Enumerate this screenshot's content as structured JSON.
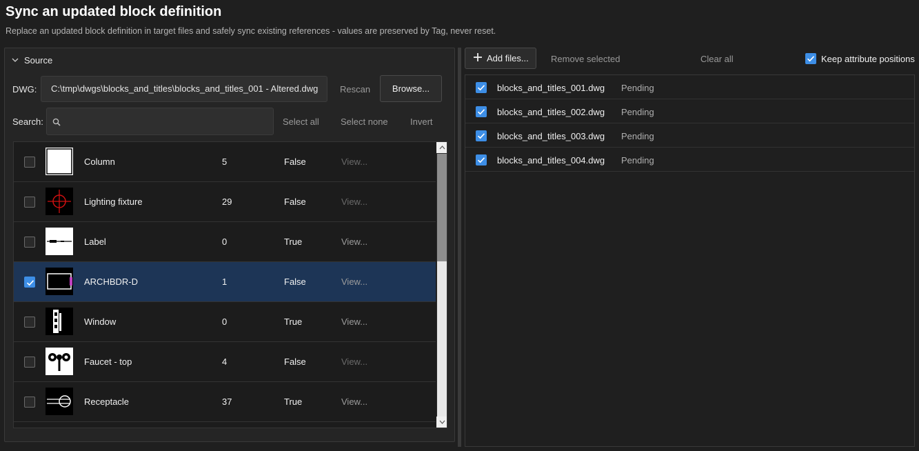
{
  "header": {
    "title": "Sync an updated block definition",
    "subtitle": "Replace an updated block definition in target files and safely sync existing references - values are preserved by Tag, never reset."
  },
  "source": {
    "section_label": "Source",
    "dwg_label": "DWG:",
    "dwg_path": "C:\\tmp\\dwgs\\blocks_and_titles\\blocks_and_titles_001 - Altered.dwg",
    "rescan_label": "Rescan",
    "browse_label": "Browse...",
    "search_label": "Search:",
    "search_value": "",
    "select_all_label": "Select all",
    "select_none_label": "Select none",
    "invert_label": "Invert"
  },
  "blocks": [
    {
      "name": "Column",
      "count": "5",
      "flag": "False",
      "view": "View...",
      "checked": false,
      "thumb": "column"
    },
    {
      "name": "Lighting fixture",
      "count": "29",
      "flag": "False",
      "view": "View...",
      "checked": false,
      "thumb": "lighting"
    },
    {
      "name": "Label",
      "count": "0",
      "flag": "True",
      "view": "View...",
      "checked": false,
      "thumb": "label"
    },
    {
      "name": "ARCHBDR-D",
      "count": "1",
      "flag": "False",
      "view": "View...",
      "checked": true,
      "thumb": "archbdr"
    },
    {
      "name": "Window",
      "count": "0",
      "flag": "True",
      "view": "View...",
      "checked": false,
      "thumb": "window"
    },
    {
      "name": "Faucet - top",
      "count": "4",
      "flag": "False",
      "view": "View...",
      "checked": false,
      "thumb": "faucet"
    },
    {
      "name": "Receptacle",
      "count": "37",
      "flag": "True",
      "view": "View...",
      "checked": false,
      "thumb": "receptacle"
    }
  ],
  "targets": {
    "add_files_label": "Add files...",
    "remove_selected_label": "Remove selected",
    "clear_all_label": "Clear all",
    "keep_positions_label": "Keep attribute positions",
    "keep_positions_checked": true,
    "files": [
      {
        "name": "blocks_and_titles_001.dwg",
        "status": "Pending",
        "checked": true
      },
      {
        "name": "blocks_and_titles_002.dwg",
        "status": "Pending",
        "checked": true
      },
      {
        "name": "blocks_and_titles_003.dwg",
        "status": "Pending",
        "checked": true
      },
      {
        "name": "blocks_and_titles_004.dwg",
        "status": "Pending",
        "checked": true
      }
    ]
  },
  "colors": {
    "accent": "#3d8ee6",
    "selected_row": "#1d3556",
    "background": "#1f1f1f"
  }
}
